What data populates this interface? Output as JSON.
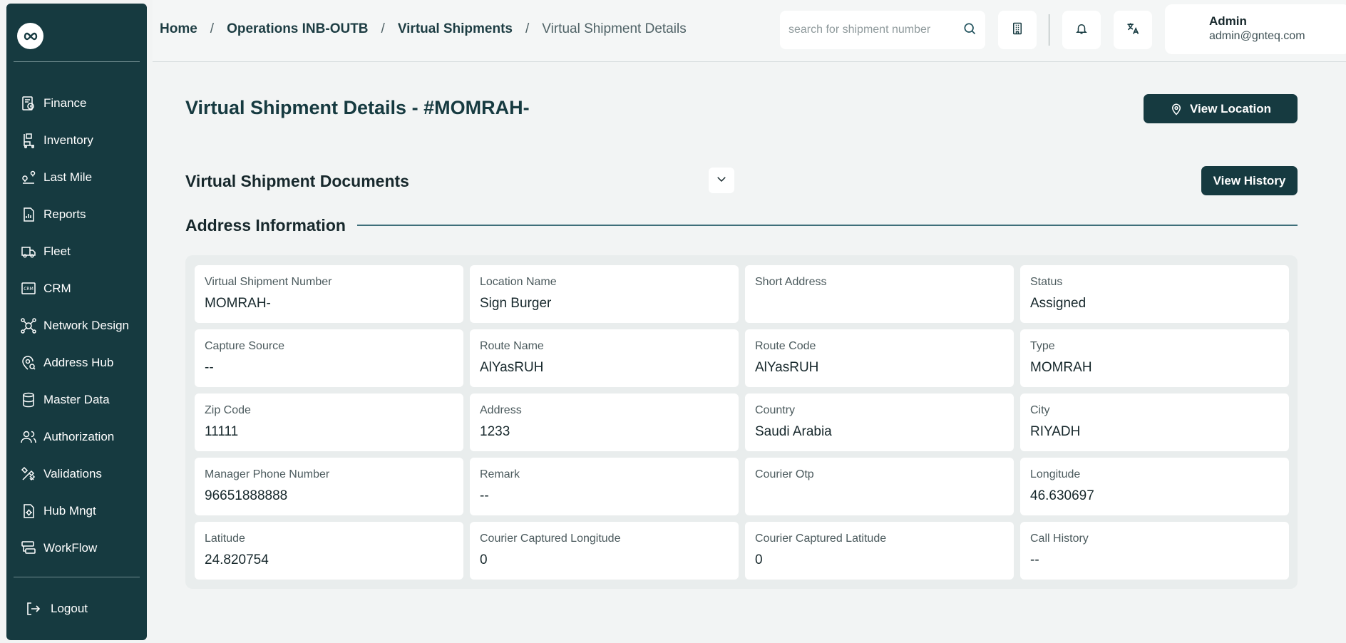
{
  "sidebar": {
    "items": [
      {
        "label": "Finance",
        "icon": "finance-icon"
      },
      {
        "label": "Inventory",
        "icon": "inventory-icon"
      },
      {
        "label": "Last Mile",
        "icon": "last-mile-icon"
      },
      {
        "label": "Reports",
        "icon": "reports-icon"
      },
      {
        "label": "Fleet",
        "icon": "truck-icon"
      },
      {
        "label": "CRM",
        "icon": "crm-icon"
      },
      {
        "label": "Network Design",
        "icon": "network-icon"
      },
      {
        "label": "Address Hub",
        "icon": "location-icon"
      },
      {
        "label": "Master Data",
        "icon": "database-icon"
      },
      {
        "label": "Authorization",
        "icon": "users-icon"
      },
      {
        "label": "Validations",
        "icon": "tools-icon"
      },
      {
        "label": "Hub Mngt",
        "icon": "hub-settings-icon"
      },
      {
        "label": "WorkFlow",
        "icon": "workflow-icon"
      }
    ],
    "logout_label": "Logout"
  },
  "header": {
    "breadcrumb": [
      "Home",
      "Operations INB-OUTB",
      "Virtual Shipments",
      "Virtual Shipment Details"
    ],
    "search_placeholder": "search for shipment number",
    "user_name": "Admin",
    "user_email": "admin@gnteq.com"
  },
  "main": {
    "title": "Virtual Shipment Details - #MOMRAH-",
    "view_location_label": "View Location",
    "documents_title": "Virtual Shipment Documents",
    "view_history_label": "View History",
    "address_title": "Address Information"
  },
  "fields": [
    {
      "label": "Virtual Shipment Number",
      "value": "MOMRAH-"
    },
    {
      "label": "Location Name",
      "value": "Sign Burger"
    },
    {
      "label": "Short Address",
      "value": ""
    },
    {
      "label": "Status",
      "value": "Assigned"
    },
    {
      "label": "Capture Source",
      "value": "--"
    },
    {
      "label": "Route Name",
      "value": "AlYasRUH"
    },
    {
      "label": "Route Code",
      "value": "AlYasRUH"
    },
    {
      "label": "Type",
      "value": "MOMRAH"
    },
    {
      "label": "Zip Code",
      "value": "11111"
    },
    {
      "label": "Address",
      "value": "1233"
    },
    {
      "label": "Country",
      "value": "Saudi Arabia"
    },
    {
      "label": "City",
      "value": "RIYADH"
    },
    {
      "label": "Manager Phone Number",
      "value": "96651888888"
    },
    {
      "label": "Remark",
      "value": "--"
    },
    {
      "label": "Courier Otp",
      "value": ""
    },
    {
      "label": "Longitude",
      "value": "46.630697"
    },
    {
      "label": "Latitude",
      "value": "24.820754"
    },
    {
      "label": "Courier Captured Longitude",
      "value": "0"
    },
    {
      "label": "Courier Captured Latitude",
      "value": "0"
    },
    {
      "label": "Call History",
      "value": "--"
    }
  ],
  "colors": {
    "sidebar_bg": "#163a40",
    "accent": "#163a40",
    "page_bg": "#f2f4f4"
  }
}
